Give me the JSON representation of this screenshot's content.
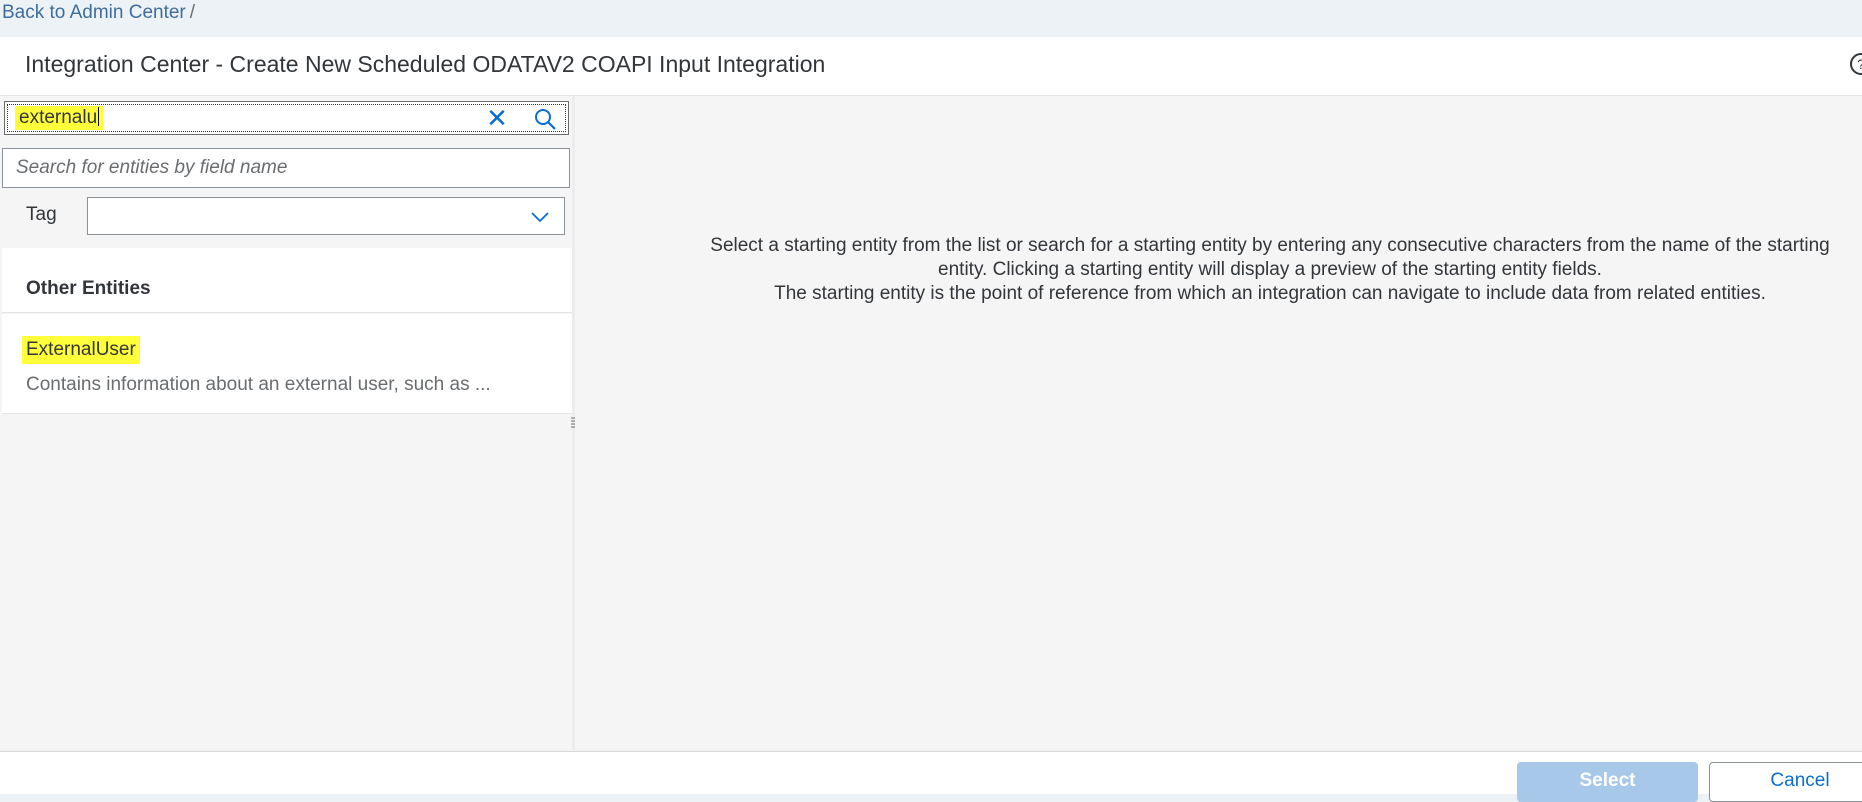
{
  "breadcrumb": {
    "back_link": "Back to Admin Center",
    "separator": "/"
  },
  "header": {
    "title": "Integration Center - Create New Scheduled ODATAV2 COAPI Input Integration",
    "help_icon": "help-icon"
  },
  "search": {
    "value": "externalu",
    "clear_icon": "close-icon",
    "search_icon": "search-icon"
  },
  "field_search": {
    "placeholder": "Search for entities by field name"
  },
  "tag": {
    "label": "Tag",
    "value": ""
  },
  "entities": {
    "group_title": "Other Entities",
    "items": [
      {
        "name": "ExternalUser",
        "description": "Contains information about an external user, such as ..."
      }
    ]
  },
  "info": {
    "line1": "Select a starting entity from the list or search for a starting entity by entering any consecutive characters from the name of the starting",
    "line2": "entity. Clicking a starting entity will display a preview of the starting entity fields.",
    "line3": "The starting entity is the point of reference from which an integration can navigate to include data from related entities."
  },
  "footer": {
    "select_label": "Select",
    "cancel_label": "Cancel"
  },
  "colors": {
    "highlight": "#ffff3a",
    "accent": "#0a6ed1",
    "link": "#3f6d9c",
    "disabled_button": "#a7c8e8"
  }
}
